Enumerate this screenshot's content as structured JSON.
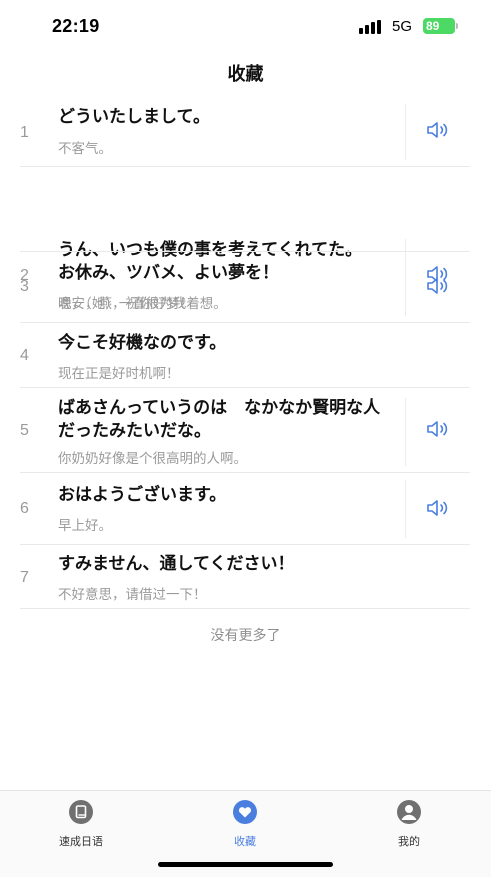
{
  "status": {
    "time": "22:19",
    "network": "5G",
    "battery": "89"
  },
  "header": {
    "title": "收藏"
  },
  "items": [
    {
      "index": "1",
      "jp": "どういたしまして。",
      "cn": "不客气。",
      "has_audio": true
    },
    {
      "index": "2",
      "jp": "うん、いつも僕の事を考えてくれてた。",
      "cn": "嗯，（她）一直很为我着想。",
      "has_audio": true
    },
    {
      "index": "3",
      "jp": "お休み、ツバメ、よい夢を！",
      "cn": "晚安，燕，祝你好梦！",
      "has_audio": true
    },
    {
      "index": "4",
      "jp": "今こそ好機なのです。",
      "cn": "现在正是好时机啊！",
      "has_audio": false
    },
    {
      "index": "5",
      "jp": "ばあさんっていうのは　なかなか賢明な人だったみたいだな。",
      "cn": "你奶奶好像是个很高明的人啊。",
      "has_audio": true
    },
    {
      "index": "6",
      "jp": "おはようございます。",
      "cn": "早上好。",
      "has_audio": true
    },
    {
      "index": "7",
      "jp": "すみません、通してください！",
      "cn": "不好意思，请借过一下！",
      "has_audio": false
    }
  ],
  "footer_text": "没有更多了",
  "tabs": [
    {
      "label": "速成日语",
      "icon": "book-icon",
      "active": false
    },
    {
      "label": "收藏",
      "icon": "heart-icon",
      "active": true
    },
    {
      "label": "我的",
      "icon": "profile-icon",
      "active": false
    }
  ],
  "colors": {
    "accent": "#4a7fe0",
    "battery": "#4cd964",
    "speaker": "#4a7fe0"
  }
}
